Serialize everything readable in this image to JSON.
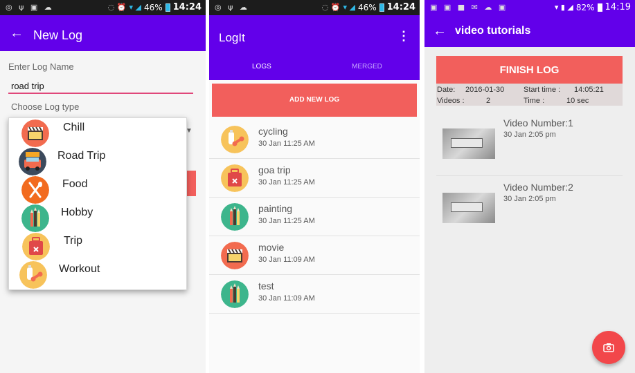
{
  "screen1": {
    "status": {
      "battery": "46%",
      "time": "14:24"
    },
    "title": "New Log",
    "log_name_label": "Enter Log Name",
    "log_name_value": "road trip",
    "log_type_label": "Choose Log type",
    "dropdown_options": [
      {
        "label": "Chill",
        "icon": "clapperboard-icon"
      },
      {
        "label": "Road Trip",
        "icon": "car-icon"
      },
      {
        "label": "Food",
        "icon": "fork-spoon-icon"
      },
      {
        "label": "Hobby",
        "icon": "pencils-icon"
      },
      {
        "label": "Trip",
        "icon": "suitcase-icon"
      },
      {
        "label": "Workout",
        "icon": "dumbbell-bottle-icon"
      }
    ]
  },
  "screen2": {
    "status": {
      "battery": "46%",
      "time": "14:24"
    },
    "title": "LogIt",
    "tabs": [
      "LOGS",
      "MERGED"
    ],
    "add_button": "ADD NEW LOG",
    "logs": [
      {
        "name": "cycling",
        "date": "30 Jan  11:25 AM",
        "icon": "dumbbell-bottle-icon"
      },
      {
        "name": "goa trip",
        "date": "30 Jan  11:25 AM",
        "icon": "suitcase-icon"
      },
      {
        "name": "painting",
        "date": "30 Jan  11:25 AM",
        "icon": "pencils-icon"
      },
      {
        "name": "movie",
        "date": "30 Jan  11:09 AM",
        "icon": "clapperboard-icon"
      },
      {
        "name": "test",
        "date": "30 Jan  11:09 AM",
        "icon": "pencils-icon"
      }
    ]
  },
  "screen3": {
    "status": {
      "battery": "82%",
      "time": "14:19"
    },
    "title": "video tutorials",
    "finish_button": "FINISH LOG",
    "info": {
      "date_label": "Date:",
      "date_value": "2016-01-30",
      "start_label": "Start time :",
      "start_value": "14:05:21",
      "videos_label": "Videos :",
      "videos_value": "2",
      "time_label": "Time :",
      "time_value": "10 sec"
    },
    "videos": [
      {
        "title": "Video Number:1",
        "date": "30 Jan  2:05 pm"
      },
      {
        "title": "Video Number:2",
        "date": "30 Jan  2:05 pm"
      }
    ],
    "fab_icon": "camera-icon"
  },
  "colors": {
    "appbar": "#6200ea",
    "accent": "#f25f5c",
    "input_underline": "#e0477a"
  }
}
